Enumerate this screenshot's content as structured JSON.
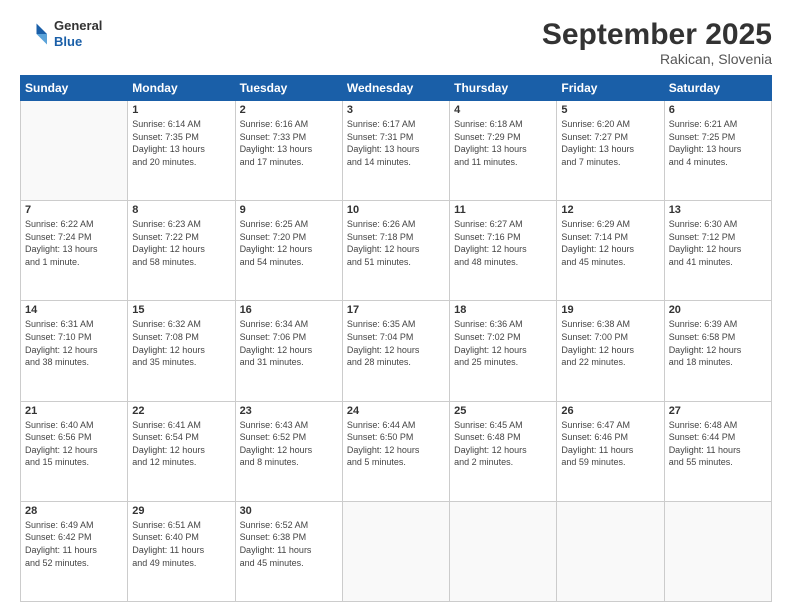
{
  "header": {
    "logo": {
      "line1": "General",
      "line2": "Blue"
    },
    "title": "September 2025",
    "location": "Rakican, Slovenia"
  },
  "days_of_week": [
    "Sunday",
    "Monday",
    "Tuesday",
    "Wednesday",
    "Thursday",
    "Friday",
    "Saturday"
  ],
  "weeks": [
    [
      {
        "day": "",
        "info": ""
      },
      {
        "day": "1",
        "info": "Sunrise: 6:14 AM\nSunset: 7:35 PM\nDaylight: 13 hours\nand 20 minutes."
      },
      {
        "day": "2",
        "info": "Sunrise: 6:16 AM\nSunset: 7:33 PM\nDaylight: 13 hours\nand 17 minutes."
      },
      {
        "day": "3",
        "info": "Sunrise: 6:17 AM\nSunset: 7:31 PM\nDaylight: 13 hours\nand 14 minutes."
      },
      {
        "day": "4",
        "info": "Sunrise: 6:18 AM\nSunset: 7:29 PM\nDaylight: 13 hours\nand 11 minutes."
      },
      {
        "day": "5",
        "info": "Sunrise: 6:20 AM\nSunset: 7:27 PM\nDaylight: 13 hours\nand 7 minutes."
      },
      {
        "day": "6",
        "info": "Sunrise: 6:21 AM\nSunset: 7:25 PM\nDaylight: 13 hours\nand 4 minutes."
      }
    ],
    [
      {
        "day": "7",
        "info": "Sunrise: 6:22 AM\nSunset: 7:24 PM\nDaylight: 13 hours\nand 1 minute."
      },
      {
        "day": "8",
        "info": "Sunrise: 6:23 AM\nSunset: 7:22 PM\nDaylight: 12 hours\nand 58 minutes."
      },
      {
        "day": "9",
        "info": "Sunrise: 6:25 AM\nSunset: 7:20 PM\nDaylight: 12 hours\nand 54 minutes."
      },
      {
        "day": "10",
        "info": "Sunrise: 6:26 AM\nSunset: 7:18 PM\nDaylight: 12 hours\nand 51 minutes."
      },
      {
        "day": "11",
        "info": "Sunrise: 6:27 AM\nSunset: 7:16 PM\nDaylight: 12 hours\nand 48 minutes."
      },
      {
        "day": "12",
        "info": "Sunrise: 6:29 AM\nSunset: 7:14 PM\nDaylight: 12 hours\nand 45 minutes."
      },
      {
        "day": "13",
        "info": "Sunrise: 6:30 AM\nSunset: 7:12 PM\nDaylight: 12 hours\nand 41 minutes."
      }
    ],
    [
      {
        "day": "14",
        "info": "Sunrise: 6:31 AM\nSunset: 7:10 PM\nDaylight: 12 hours\nand 38 minutes."
      },
      {
        "day": "15",
        "info": "Sunrise: 6:32 AM\nSunset: 7:08 PM\nDaylight: 12 hours\nand 35 minutes."
      },
      {
        "day": "16",
        "info": "Sunrise: 6:34 AM\nSunset: 7:06 PM\nDaylight: 12 hours\nand 31 minutes."
      },
      {
        "day": "17",
        "info": "Sunrise: 6:35 AM\nSunset: 7:04 PM\nDaylight: 12 hours\nand 28 minutes."
      },
      {
        "day": "18",
        "info": "Sunrise: 6:36 AM\nSunset: 7:02 PM\nDaylight: 12 hours\nand 25 minutes."
      },
      {
        "day": "19",
        "info": "Sunrise: 6:38 AM\nSunset: 7:00 PM\nDaylight: 12 hours\nand 22 minutes."
      },
      {
        "day": "20",
        "info": "Sunrise: 6:39 AM\nSunset: 6:58 PM\nDaylight: 12 hours\nand 18 minutes."
      }
    ],
    [
      {
        "day": "21",
        "info": "Sunrise: 6:40 AM\nSunset: 6:56 PM\nDaylight: 12 hours\nand 15 minutes."
      },
      {
        "day": "22",
        "info": "Sunrise: 6:41 AM\nSunset: 6:54 PM\nDaylight: 12 hours\nand 12 minutes."
      },
      {
        "day": "23",
        "info": "Sunrise: 6:43 AM\nSunset: 6:52 PM\nDaylight: 12 hours\nand 8 minutes."
      },
      {
        "day": "24",
        "info": "Sunrise: 6:44 AM\nSunset: 6:50 PM\nDaylight: 12 hours\nand 5 minutes."
      },
      {
        "day": "25",
        "info": "Sunrise: 6:45 AM\nSunset: 6:48 PM\nDaylight: 12 hours\nand 2 minutes."
      },
      {
        "day": "26",
        "info": "Sunrise: 6:47 AM\nSunset: 6:46 PM\nDaylight: 11 hours\nand 59 minutes."
      },
      {
        "day": "27",
        "info": "Sunrise: 6:48 AM\nSunset: 6:44 PM\nDaylight: 11 hours\nand 55 minutes."
      }
    ],
    [
      {
        "day": "28",
        "info": "Sunrise: 6:49 AM\nSunset: 6:42 PM\nDaylight: 11 hours\nand 52 minutes."
      },
      {
        "day": "29",
        "info": "Sunrise: 6:51 AM\nSunset: 6:40 PM\nDaylight: 11 hours\nand 49 minutes."
      },
      {
        "day": "30",
        "info": "Sunrise: 6:52 AM\nSunset: 6:38 PM\nDaylight: 11 hours\nand 45 minutes."
      },
      {
        "day": "",
        "info": ""
      },
      {
        "day": "",
        "info": ""
      },
      {
        "day": "",
        "info": ""
      },
      {
        "day": "",
        "info": ""
      }
    ]
  ]
}
